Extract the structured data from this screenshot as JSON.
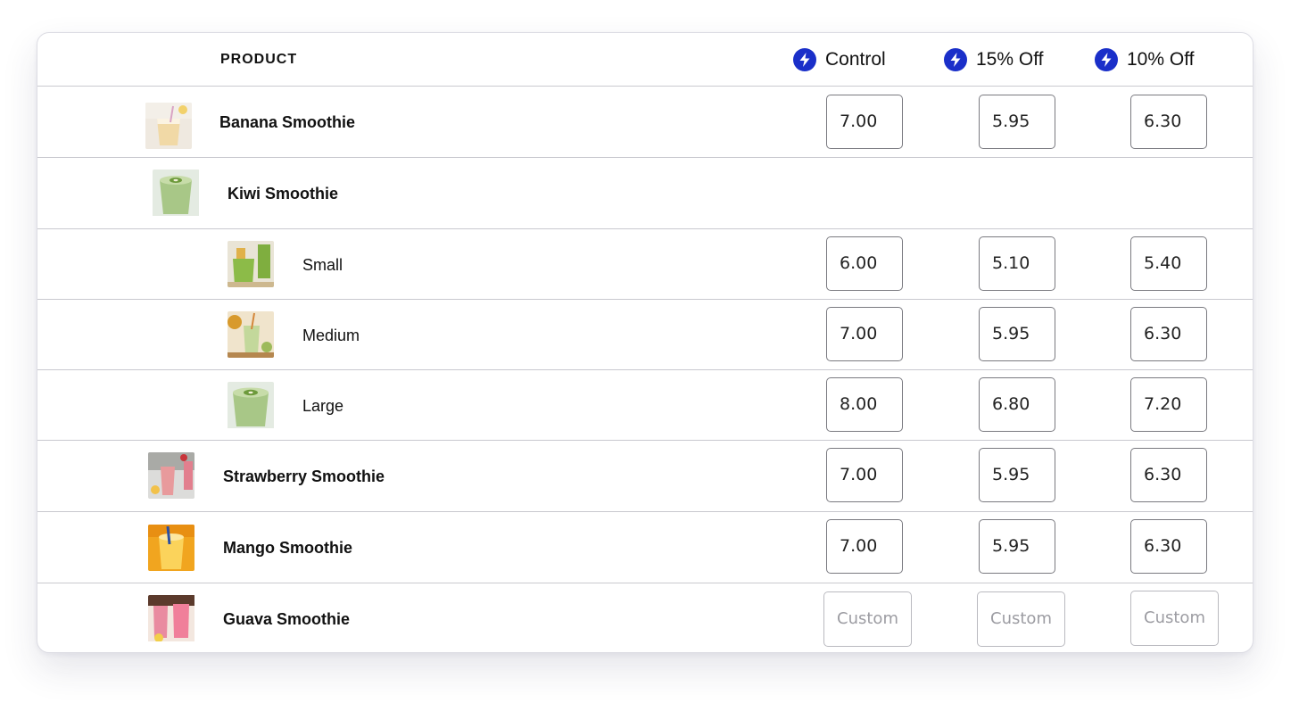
{
  "table": {
    "product_header": "PRODUCT",
    "columns": [
      {
        "label": "Control",
        "icon": "lightning-bolt-icon"
      },
      {
        "label": "15% Off",
        "icon": "lightning-bolt-icon"
      },
      {
        "label": "10% Off",
        "icon": "lightning-bolt-icon"
      }
    ],
    "accent_color": "#1a2fc9",
    "rows": [
      {
        "name": "Banana Smoothie",
        "prices": [
          "7.00",
          "5.95",
          "6.30"
        ]
      },
      {
        "name": "Kiwi Smoothie"
      },
      {
        "name": "Small",
        "prices": [
          "6.00",
          "5.10",
          "5.40"
        ]
      },
      {
        "name": "Medium",
        "prices": [
          "7.00",
          "5.95",
          "6.30"
        ]
      },
      {
        "name": "Large",
        "prices": [
          "8.00",
          "6.80",
          "7.20"
        ]
      },
      {
        "name": "Strawberry Smoothie",
        "prices": [
          "7.00",
          "5.95",
          "6.30"
        ]
      },
      {
        "name": "Mango Smoothie",
        "prices": [
          "7.00",
          "5.95",
          "6.30"
        ]
      },
      {
        "name": "Guava Smoothie",
        "placeholders": [
          "Custom",
          "Custom",
          "Custom"
        ]
      }
    ]
  }
}
